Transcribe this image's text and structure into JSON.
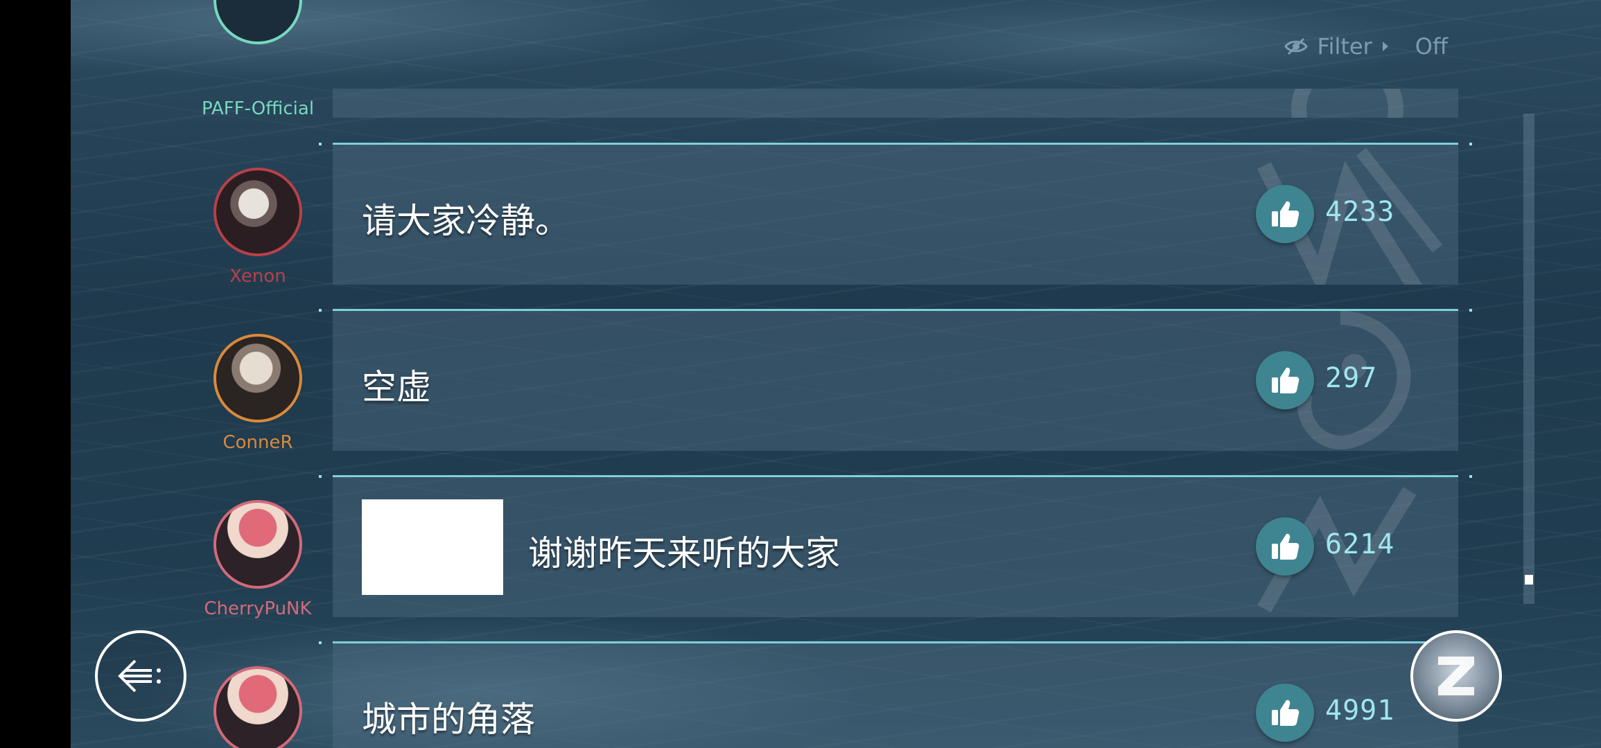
{
  "filter": {
    "label": "Filter",
    "value": "Off",
    "icon": "eye-slash-icon"
  },
  "comments": [
    {
      "username": "PAFF-Official",
      "name_color": "#78d8c0",
      "message": "",
      "likes": "",
      "has_image": false,
      "partial": true
    },
    {
      "username": "Xenon",
      "name_color": "#b8404a",
      "message": "请大家冷静。",
      "likes": "4233",
      "has_image": false
    },
    {
      "username": "ConneR",
      "name_color": "#d98a3c",
      "message": "空虚",
      "likes": "297",
      "has_image": false
    },
    {
      "username": "CherryPuNK",
      "name_color": "#d36a7a",
      "message": "谢谢昨天来听的大家",
      "likes": "6214",
      "has_image": true
    },
    {
      "username": "",
      "name_color": "#d36a7a",
      "message": "城市的角落",
      "likes": "4991",
      "has_image": false
    }
  ],
  "colors": {
    "accent": "#7fd0da",
    "like_button": "#3f8591",
    "like_count": "#9ee7ee"
  }
}
